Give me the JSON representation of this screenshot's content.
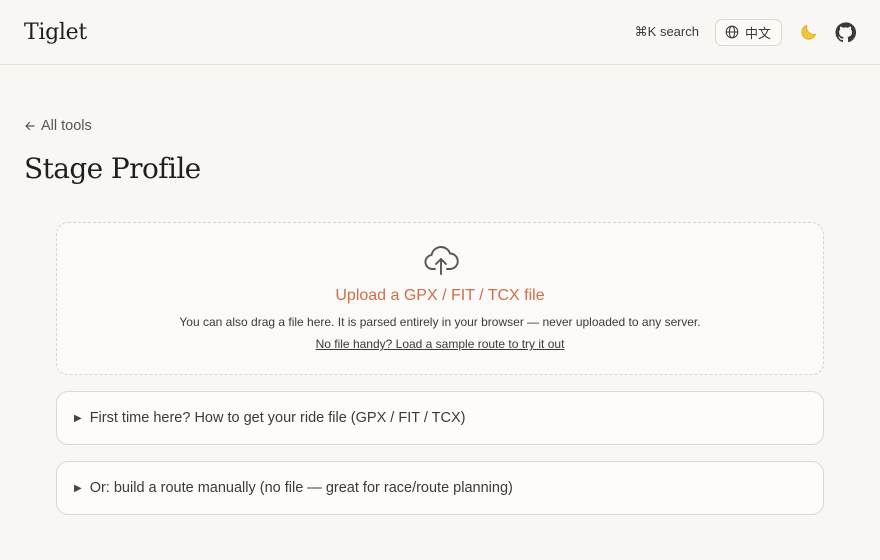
{
  "header": {
    "brand": "Tiglet",
    "search_hint": "⌘K search",
    "language_label": "中文"
  },
  "nav": {
    "back_label": "All tools"
  },
  "page": {
    "title": "Stage Profile"
  },
  "upload": {
    "title": "Upload a GPX / FIT / TCX file",
    "description": "You can also drag a file here. It is parsed entirely in your browser — never uploaded to any server.",
    "sample_link": "No file handy? Load a sample route to try it out"
  },
  "accordions": [
    {
      "label": "First time here? How to get your ride file (GPX / FIT / TCX)"
    },
    {
      "label": "Or: build a route manually (no file — great for race/route planning)"
    }
  ],
  "colors": {
    "accent": "#cf6e47",
    "background": "#f9f7f3"
  }
}
